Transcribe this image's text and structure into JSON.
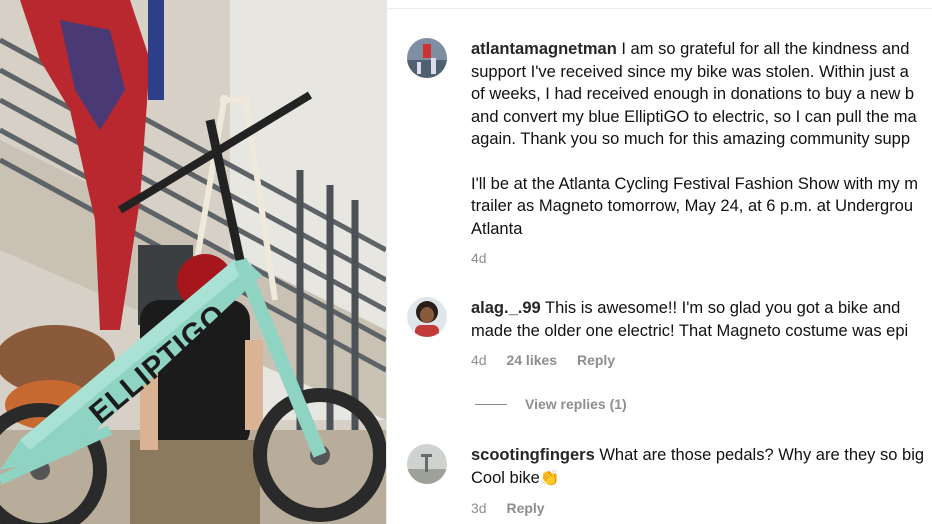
{
  "photo": {
    "bike_brand": "ELLIPTIGO",
    "alt": "Person holding a mint green ElliptiGO bike"
  },
  "comments": [
    {
      "username": "atlantamagnetman",
      "lines": [
        "I am so grateful for all the kindness and",
        "support I've received since my bike was stolen. Within just a",
        "of weeks, I had received enough in donations to buy a new b",
        "and convert my blue ElliptiGO to electric, so I can pull the ma",
        "again. Thank you so much for this amazing community supp"
      ],
      "lines2": [
        "I'll be at the Atlanta Cycling Festival Fashion Show with my m",
        "trailer as Magneto tomorrow, May 24, at 6 p.m. at Undergrou",
        "Atlanta"
      ],
      "time": "4d"
    },
    {
      "username": "alag._.99",
      "lines": [
        "This is awesome!! I'm so glad you got a bike and",
        "made the older one electric! That Magneto costume was epi"
      ],
      "time": "4d",
      "likes": "24 likes",
      "reply": "Reply",
      "view_replies": "View replies (1)"
    },
    {
      "username": "scootingfingers",
      "lines": [
        "What are those pedals? Why are they so big",
        "Cool bike"
      ],
      "emoji": "👏",
      "time": "3d",
      "reply": "Reply"
    }
  ]
}
